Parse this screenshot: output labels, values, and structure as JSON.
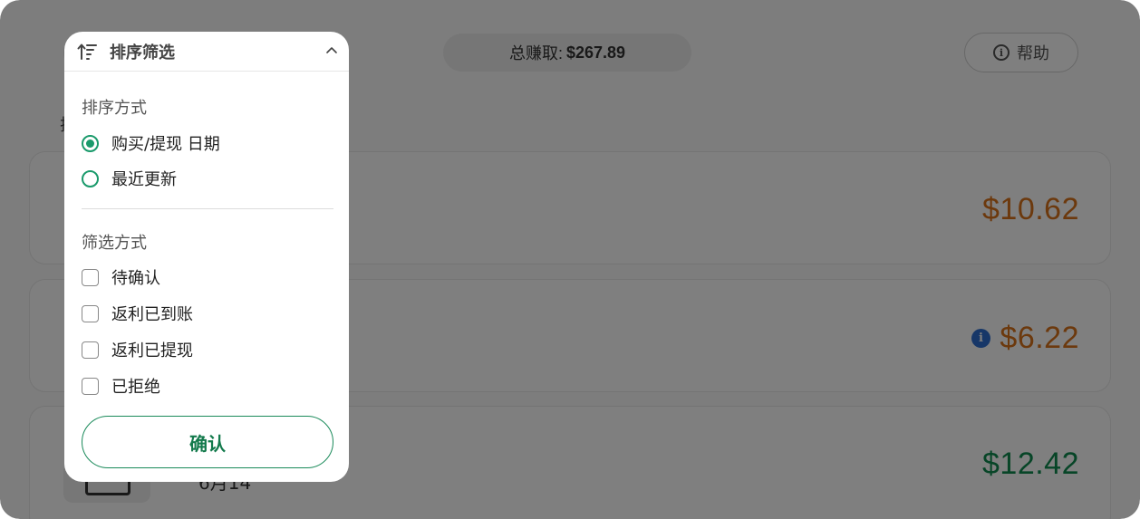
{
  "header": {
    "sort_title": "排序筛选",
    "total_label": "总赚取:",
    "total_value": "$267.89",
    "help_label": "帮助"
  },
  "section_hint": "排",
  "cards": [
    {
      "amount": "$10.62",
      "amount_color": "#d9731a",
      "info": false
    },
    {
      "amount": "$6.22",
      "amount_color": "#d9731a",
      "info": true
    },
    {
      "amount": "$12.42",
      "amount_color": "#0f8a4f",
      "info": false,
      "date": "6月14"
    }
  ],
  "panel": {
    "title": "排序筛选",
    "sort_group_label": "排序方式",
    "sort_options": [
      {
        "label": "购买/提现 日期",
        "selected": true
      },
      {
        "label": "最近更新",
        "selected": false
      }
    ],
    "filter_group_label": "筛选方式",
    "filter_options": [
      {
        "label": "待确认",
        "checked": false
      },
      {
        "label": "返利已到账",
        "checked": false
      },
      {
        "label": "返利已提现",
        "checked": false
      },
      {
        "label": "已拒绝",
        "checked": false
      }
    ],
    "confirm_label": "确认"
  },
  "colors": {
    "accent_green": "#1a9a6b",
    "pending_orange": "#d9731a",
    "credited_green": "#0f8a4f",
    "info_blue": "#2f6fd0"
  },
  "icons": {
    "sort": "sort-ascending-icon",
    "collapse": "chevron-up-icon",
    "help": "info-circle-icon",
    "info": "info-badge-icon"
  }
}
